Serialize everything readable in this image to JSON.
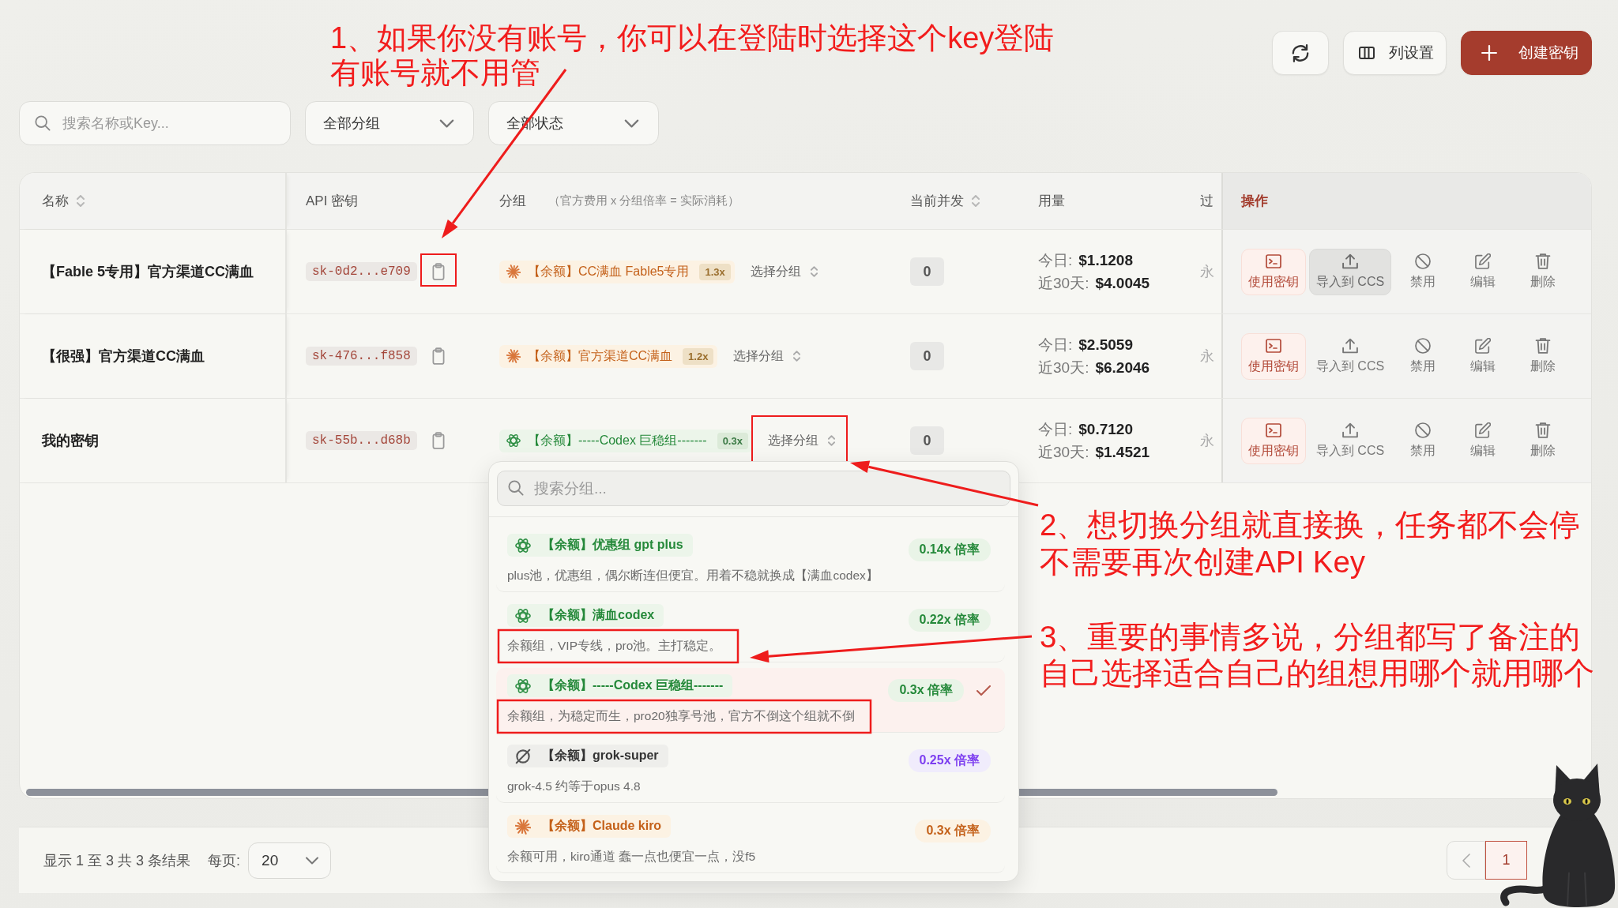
{
  "toolbar": {
    "buttons": [
      {
        "kind": "refresh"
      },
      {
        "kind": "columns",
        "label": "列设置"
      },
      {
        "kind": "create",
        "label": "创建密钥"
      }
    ]
  },
  "filters": {
    "search": {
      "placeholder": "搜索名称或Key..."
    },
    "dropdowns": [
      {
        "value": "全部分组"
      },
      {
        "value": "全部状态"
      }
    ]
  },
  "table": {
    "columns": [
      {
        "label": "名称",
        "sortable": true
      },
      {
        "label": "API 密钥",
        "sortable": false
      },
      {
        "label": "分组",
        "note": "（官方费用 x 分组倍率 = 实际消耗）",
        "sortable": false
      },
      {
        "label": "当前并发",
        "sortable": true
      },
      {
        "label": "用量",
        "sortable": false
      },
      {
        "label": "过",
        "sortable": false
      },
      {
        "label": "操作",
        "sortable": false
      }
    ],
    "rows": [
      {
        "name": "【Fable 5专用】官方渠道CC满血",
        "key": "sk-0d2...e709",
        "group": {
          "kind": "claude",
          "label": "【余额】CC满血 Fable5专用",
          "ratio": "1.3x"
        },
        "picker": "选择分组",
        "concurrency": "0",
        "usage": [
          {
            "label": "今日:",
            "value": "$1.1208"
          },
          {
            "label": "近30天:",
            "value": "$4.0045"
          }
        ],
        "expiry": "永",
        "actions": [
          {
            "kind": "use_key",
            "label": "使用密钥",
            "hovered": false
          },
          {
            "kind": "import",
            "label": "导入到 CCS",
            "hovered": true
          },
          {
            "kind": "disable",
            "label": "禁用",
            "hovered": false
          },
          {
            "kind": "edit",
            "label": "编辑",
            "hovered": false
          },
          {
            "kind": "delete",
            "label": "删除",
            "hovered": false
          }
        ]
      },
      {
        "name": "【很强】官方渠道CC满血",
        "key": "sk-476...f858",
        "group": {
          "kind": "claude",
          "label": "【余额】官方渠道CC满血",
          "ratio": "1.2x"
        },
        "picker": "选择分组",
        "concurrency": "0",
        "usage": [
          {
            "label": "今日:",
            "value": "$2.5059"
          },
          {
            "label": "近30天:",
            "value": "$6.2046"
          }
        ],
        "expiry": "永",
        "actions": [
          {
            "kind": "use_key",
            "label": "使用密钥",
            "hovered": false
          },
          {
            "kind": "import",
            "label": "导入到 CCS",
            "hovered": false
          },
          {
            "kind": "disable",
            "label": "禁用",
            "hovered": false
          },
          {
            "kind": "edit",
            "label": "编辑",
            "hovered": false
          },
          {
            "kind": "delete",
            "label": "删除",
            "hovered": false
          }
        ]
      },
      {
        "name": "我的密钥",
        "key": "sk-55b...d68b",
        "group": {
          "kind": "openai",
          "label": "【余额】-----Codex 巨稳组-------",
          "ratio": "0.3x"
        },
        "picker": "选择分组",
        "concurrency": "0",
        "usage": [
          {
            "label": "今日:",
            "value": "$0.7120"
          },
          {
            "label": "近30天:",
            "value": "$1.4521"
          }
        ],
        "expiry": "永",
        "actions": [
          {
            "kind": "use_key",
            "label": "使用密钥",
            "hovered": false
          },
          {
            "kind": "import",
            "label": "导入到 CCS",
            "hovered": false
          },
          {
            "kind": "disable",
            "label": "禁用",
            "hovered": false
          },
          {
            "kind": "edit",
            "label": "编辑",
            "hovered": false
          },
          {
            "kind": "delete",
            "label": "删除",
            "hovered": false
          }
        ]
      }
    ]
  },
  "group_menu": {
    "search": {
      "placeholder": "搜索分组..."
    },
    "items": [
      {
        "kind": "openai",
        "title": "【余额】优惠组 gpt plus",
        "ratio": "0.14x 倍率",
        "description": "plus池，优惠组，偶尔断连但便宜。用着不稳就换成【满血codex】",
        "selected": false
      },
      {
        "kind": "openai",
        "title": "【余额】满血codex",
        "ratio": "0.22x 倍率",
        "description": "余额组，VIP专线，pro池。主打稳定。",
        "selected": false
      },
      {
        "kind": "openai",
        "title": "【余额】-----Codex 巨稳组-------",
        "ratio": "0.3x 倍率",
        "description": "余额组，为稳定而生，pro20独享号池，官方不倒这个组就不倒",
        "selected": true
      },
      {
        "kind": "grok",
        "title": "【余额】grok-super",
        "ratio": "0.25x 倍率",
        "description": "grok-4.5 约等于opus 4.8",
        "selected": false
      },
      {
        "kind": "claude",
        "title": "【余额】Claude kiro",
        "ratio": "0.3x 倍率",
        "description": "余额可用，kiro通道 蠢一点也便宜一点，没f5",
        "selected": false
      }
    ]
  },
  "footer": {
    "summary": "显示 1 至 3 共 3 条结果",
    "page_size_label": "每页:",
    "page_size": "20",
    "pages": [
      {
        "label": "1",
        "selected": true
      }
    ]
  },
  "annotations": [
    {
      "lines": [
        "1、如果你没有账号，你可以在登陆时选择这个key登陆",
        "有账号就不用管"
      ]
    },
    {
      "lines": [
        "2、想切换分组就直接换，任务都不会停",
        "不需要再次创建API Key"
      ]
    },
    {
      "lines": [
        "3、重要的事情多说，分组都写了备注的",
        "自己选择适合自己的组想用哪个就用哪个"
      ]
    }
  ]
}
